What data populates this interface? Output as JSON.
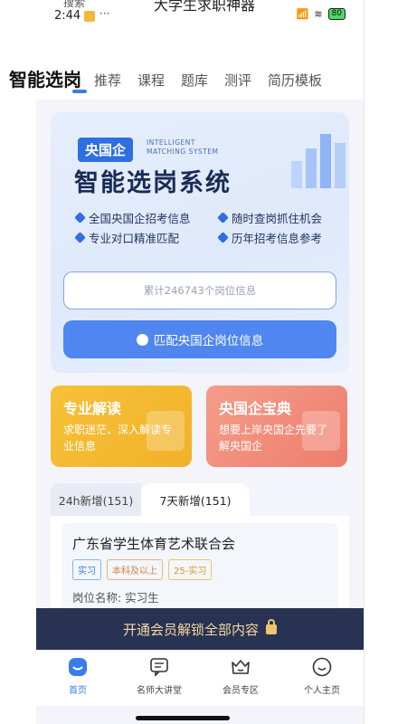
{
  "status_bar": {
    "time": "2:44",
    "search_label": "搜索",
    "app_name": "大学生求职神器",
    "dots": "···",
    "battery": "80"
  },
  "top_tabs": [
    {
      "label": "智能选岗",
      "active": true
    },
    {
      "label": "推荐"
    },
    {
      "label": "课程"
    },
    {
      "label": "题库"
    },
    {
      "label": "测评"
    },
    {
      "label": "简历模板"
    }
  ],
  "hero": {
    "tag": "央国企",
    "en_line1": "INTELLIGENT",
    "en_line2": "MATCHING SYSTEM",
    "title": "智能选岗系统",
    "features": [
      "全国央国企招考信息",
      "随时查岗抓住机会",
      "专业对口精准匹配",
      "历年招考信息参考"
    ],
    "input_placeholder": "累计246743个岗位信息",
    "button_label": "匹配央国企岗位信息"
  },
  "cards": [
    {
      "title": "专业解读",
      "desc": "求职迷茫、深入解读专业信息"
    },
    {
      "title": "央国企宝典",
      "desc": "想要上岸央国企先要了解央国企"
    }
  ],
  "list_tabs": [
    {
      "label": "24h新增(151)"
    },
    {
      "label": "7天新增(151)",
      "active": true
    }
  ],
  "job": {
    "title": "广东省学生体育艺术联合会",
    "tags": [
      "实习",
      "本科及以上",
      "25-实习"
    ],
    "position": "岗位名称:  实习生"
  },
  "vip_bar": {
    "label": "开通会员解锁全部内容"
  },
  "bottom_nav": [
    {
      "label": "首页",
      "icon": "home-icon",
      "active": true
    },
    {
      "label": "名师大讲堂",
      "icon": "lecture-icon"
    },
    {
      "label": "会员专区",
      "icon": "crown-icon"
    },
    {
      "label": "个人主页",
      "icon": "profile-icon"
    }
  ],
  "colors": {
    "accent": "#3b7ce8",
    "vip_bg": "#283252",
    "card_yellow": "#f3b834",
    "card_red": "#f08a78"
  }
}
